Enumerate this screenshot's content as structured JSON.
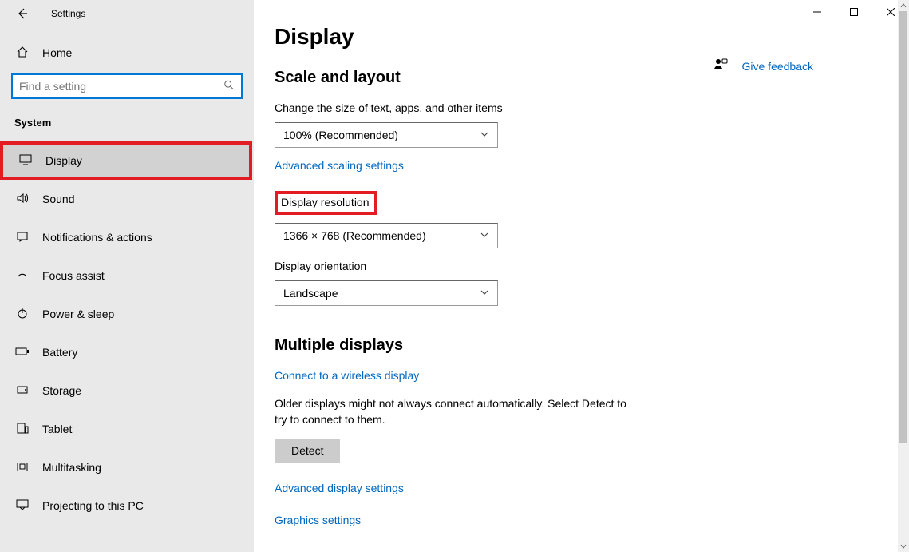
{
  "window": {
    "title": "Settings"
  },
  "sidebar": {
    "home": "Home",
    "search_placeholder": "Find a setting",
    "section": "System",
    "items": [
      {
        "label": "Display",
        "active": true
      },
      {
        "label": "Sound"
      },
      {
        "label": "Notifications & actions"
      },
      {
        "label": "Focus assist"
      },
      {
        "label": "Power & sleep"
      },
      {
        "label": "Battery"
      },
      {
        "label": "Storage"
      },
      {
        "label": "Tablet"
      },
      {
        "label": "Multitasking"
      },
      {
        "label": "Projecting to this PC"
      }
    ]
  },
  "main": {
    "page_title": "Display",
    "scale_section": {
      "heading": "Scale and layout",
      "size_label": "Change the size of text, apps, and other items",
      "size_value": "100% (Recommended)",
      "adv_scaling": "Advanced scaling settings",
      "resolution_label": "Display resolution",
      "resolution_value": "1366 × 768 (Recommended)",
      "orientation_label": "Display orientation",
      "orientation_value": "Landscape"
    },
    "multiple": {
      "heading": "Multiple displays",
      "wireless": "Connect to a wireless display",
      "note": "Older displays might not always connect automatically. Select Detect to try to connect to them.",
      "detect": "Detect",
      "adv_display": "Advanced display settings",
      "graphics": "Graphics settings"
    },
    "feedback": "Give feedback"
  }
}
